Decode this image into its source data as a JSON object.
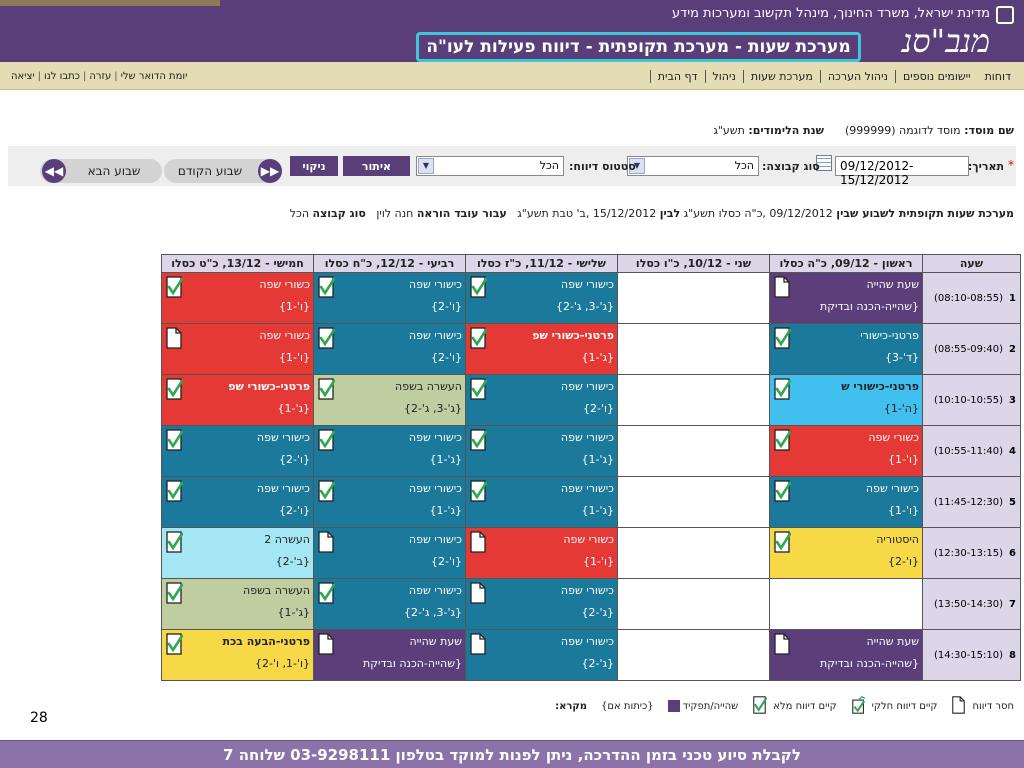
{
  "header": {
    "ministry": "מדינת ישראל, משרד החינוך, מינהל תקשוב ומערכות מידע",
    "logo_text": "מנב\"סנ",
    "system_title": "מערכת שעות - מערכת תקופתית - דיווח פעילות לעו\"ה"
  },
  "nav": {
    "items": [
      {
        "label": "דף הבית"
      },
      {
        "label": "ניהול"
      },
      {
        "label": "מערכת שעות"
      },
      {
        "label": "ניהול הערכה"
      },
      {
        "label": "יישומים נוספים"
      },
      {
        "label": "דוחות"
      }
    ],
    "utility": [
      {
        "label": "יומת הדואר שלי"
      },
      {
        "label": "עזרה"
      },
      {
        "label": "כתבו לנו"
      },
      {
        "label": "יציאה"
      }
    ]
  },
  "info": {
    "institution_label": "שם מוסד:",
    "institution_value": "מוסד לדוגמה (999999)",
    "year_label": "שנת הלימודים:",
    "year_value": "תשע\"ג"
  },
  "filters": {
    "required_mark": "*",
    "date_label": "תאריך:",
    "date_value": "09/12/2012-15/12/2012",
    "group_type_label": "סוג קבוצה:",
    "group_type_value": "הכל",
    "report_status_label": "סטטוס דיווח:",
    "report_status_value": "הכל",
    "filter_button": "איתור",
    "clear_button": "ניקוי",
    "prev_week_button": "שבוע הקודם",
    "next_week_button": "שבוע הבא"
  },
  "summary": {
    "title": "מערכת שעות תקופתית לשבוע שבין",
    "range_from": "09/12/2012 ,כ\"ה כסלו תשע\"ג",
    "between_word": "לבין",
    "range_to": "15/12/2012 ,ב' טבת תשע\"ג",
    "staff_label": "עבור עובד הוראה",
    "staff_value": "חנה לוין",
    "group_type_label": "סוג קבוצה",
    "group_type_value": "הכל"
  },
  "timetable": {
    "hour_header": "שעה",
    "days": [
      "ראשון - 09/12, כ\"ה כסלו",
      "שני - 10/12, כ\"ו כסלו",
      "שלישי - 11/12, כ\"ז כסלו",
      "רביעי - 12/12, כ\"ח כסלו",
      "חמישי - 13/12, כ\"ט כסלו"
    ],
    "rows": [
      {
        "num": "1",
        "time": "(08:10-08:55)",
        "cells": [
          {
            "name": "שעת שהייה",
            "group": "{שהייה-הכנה ובדיקת",
            "color": "purple",
            "status": "missing"
          },
          {
            "empty": true
          },
          {
            "name": "כישורי שפה",
            "group": "{ג'-3, ג'-2}",
            "color": "blue",
            "status": "full"
          },
          {
            "name": "כישורי שפה",
            "group": "{ו'-2}",
            "color": "blue",
            "status": "full"
          },
          {
            "name": "כשורי שפה",
            "group": "{ו'-1}",
            "color": "red",
            "status": "full"
          }
        ]
      },
      {
        "num": "2",
        "time": "(08:55-09:40)",
        "cells": [
          {
            "name": "פרטני-כישורי",
            "group": "{ד'-3}",
            "color": "blue",
            "status": "full"
          },
          {
            "empty": true
          },
          {
            "name": "פרטני-כשורי שפ",
            "group": "{ג'-1}",
            "color": "red",
            "status": "full",
            "bold": true
          },
          {
            "name": "כישורי שפה",
            "group": "{ו'-2}",
            "color": "blue",
            "status": "full"
          },
          {
            "name": "כשורי שפה",
            "group": "{ו'-1}",
            "color": "red",
            "status": "missing"
          }
        ]
      },
      {
        "num": "3",
        "time": "(10:10-10:55)",
        "cells": [
          {
            "name": "פרטני-כישורי ש",
            "group": "{ה'-1}",
            "color": "sky",
            "status": "full",
            "bold": true
          },
          {
            "empty": true
          },
          {
            "name": "כישורי שפה",
            "group": "{ו'-2}",
            "color": "blue",
            "status": "full"
          },
          {
            "name": "העשרה בשפה",
            "group": "{ג'-3, ג'-2}",
            "color": "sage",
            "status": "full"
          },
          {
            "name": "פרטני-כשורי שפ",
            "group": "{ג'-1}",
            "color": "red",
            "status": "full",
            "bold": true
          }
        ]
      },
      {
        "num": "4",
        "time": "(10:55-11:40)",
        "cells": [
          {
            "name": "כשורי שפה",
            "group": "{ו'-1}",
            "color": "red",
            "status": "full"
          },
          {
            "empty": true
          },
          {
            "name": "כישורי שפה",
            "group": "{ג'-1}",
            "color": "blue",
            "status": "full"
          },
          {
            "name": "כישורי שפה",
            "group": "{ג'-1}",
            "color": "blue",
            "status": "full"
          },
          {
            "name": "כישורי שפה",
            "group": "{ו'-2}",
            "color": "blue",
            "status": "full"
          }
        ]
      },
      {
        "num": "5",
        "time": "(11:45-12:30)",
        "cells": [
          {
            "name": "כישורי שפה",
            "group": "{ו'-1}",
            "color": "blue",
            "status": "full"
          },
          {
            "empty": true
          },
          {
            "name": "כישורי שפה",
            "group": "{ג'-1}",
            "color": "blue",
            "status": "full"
          },
          {
            "name": "כישורי שפה",
            "group": "{ג'-1}",
            "color": "blue",
            "status": "full"
          },
          {
            "name": "כישורי שפה",
            "group": "{ו'-2}",
            "color": "blue",
            "status": "full"
          }
        ]
      },
      {
        "num": "6",
        "time": "(12:30-13:15)",
        "cells": [
          {
            "name": "היסטוריה",
            "group": "{ו'-2}",
            "color": "yellow",
            "status": "full"
          },
          {
            "empty": true
          },
          {
            "name": "כשורי שפה",
            "group": "{ו'-1}",
            "color": "red",
            "status": "missing"
          },
          {
            "name": "כישורי שפה",
            "group": "{ו'-2}",
            "color": "blue",
            "status": "missing"
          },
          {
            "name": "העשרה 2",
            "group": "{ב'-2}",
            "color": "lightblue",
            "status": "full"
          }
        ]
      },
      {
        "num": "7",
        "time": "(13:50-14:30)",
        "cells": [
          {
            "empty": true
          },
          {
            "empty": true
          },
          {
            "name": "כישורי שפה",
            "group": "{ג'-2}",
            "color": "blue",
            "status": "missing"
          },
          {
            "name": "כישורי שפה",
            "group": "{ג'-3, ג'-2}",
            "color": "blue",
            "status": "full"
          },
          {
            "name": "העשרה בשפה",
            "group": "{ג'-1}",
            "color": "sage",
            "status": "full"
          }
        ]
      },
      {
        "num": "8",
        "time": "(14:30-15:10)",
        "cells": [
          {
            "name": "שעת שהייה",
            "group": "{שהייה-הכנה ובדיקת",
            "color": "purple",
            "status": "missing"
          },
          {
            "empty": true
          },
          {
            "name": "כישורי שפה",
            "group": "{ג'-2}",
            "color": "blue",
            "status": "missing"
          },
          {
            "name": "שעת שהייה",
            "group": "{שהייה-הכנה ובדיקת",
            "color": "purple",
            "status": "missing"
          },
          {
            "name": "פרטני-הבעה בכת",
            "group": "{ו'-1, ו'-2}",
            "color": "yellow",
            "status": "full",
            "bold": true
          }
        ]
      }
    ]
  },
  "legend": {
    "title": "מקרא:",
    "items": [
      {
        "label": "{כיתות אם}",
        "kind": "text"
      },
      {
        "label": "שהייה/תפקיד",
        "kind": "swatch"
      },
      {
        "label": "קיים דיווח מלא",
        "kind": "full"
      },
      {
        "label": "קיים דיווח חלקי",
        "kind": "partial"
      },
      {
        "label": "חסר דיווח",
        "kind": "missing"
      }
    ]
  },
  "page_number": "28",
  "footer": "לקבלת סיוע טכני בזמן ההדרכה, ניתן לפנות למוקד בטלפון 03-9298111 שלוחה 7",
  "colors": {
    "purple": "#5b3e7a",
    "blue": "#1b7a9b",
    "red": "#e53935",
    "yellow": "#f7d948",
    "lightblue": "#a4e6f3",
    "sage": "#bfcea0",
    "sky": "#3fc0ee",
    "header_bg": "#5a3e7a",
    "nav_bg": "#e3dcb4",
    "title_border": "#3fc6d6",
    "footer_bg": "#8b72a8"
  }
}
